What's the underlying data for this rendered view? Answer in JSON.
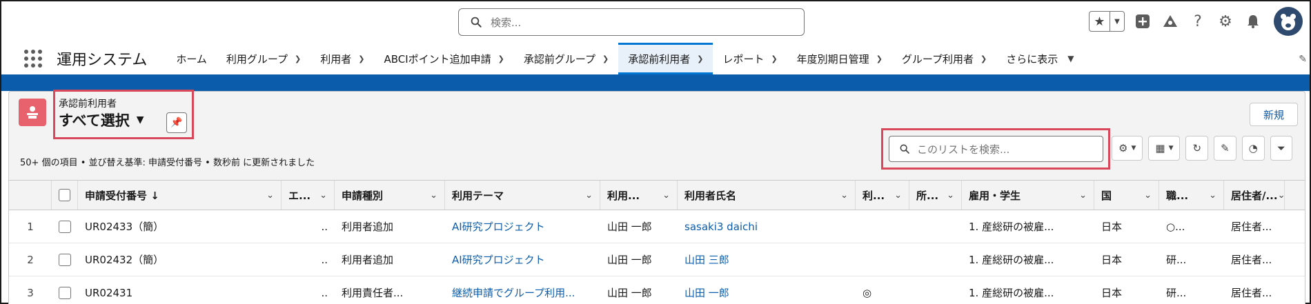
{
  "header": {
    "search_placeholder": "検索...",
    "icons": [
      "search-icon",
      "star-icon",
      "chevron-down-icon",
      "plus-icon",
      "trailhead-icon",
      "help-icon",
      "gear-icon",
      "bell-icon",
      "avatar"
    ]
  },
  "nav": {
    "app_name": "運用システム",
    "items": [
      {
        "label": "ホーム",
        "dropdown": false
      },
      {
        "label": "利用グループ",
        "dropdown": true
      },
      {
        "label": "利用者",
        "dropdown": true
      },
      {
        "label": "ABCIポイント追加申請",
        "dropdown": true
      },
      {
        "label": "承認前グループ",
        "dropdown": true
      },
      {
        "label": "承認前利用者",
        "dropdown": true,
        "active": true
      },
      {
        "label": "レポート",
        "dropdown": true
      },
      {
        "label": "年度別期日管理",
        "dropdown": true
      },
      {
        "label": "グループ利用者",
        "dropdown": true
      }
    ],
    "more_label": "さらに表示"
  },
  "list": {
    "object_label": "承認前利用者",
    "view_title": "すべて選択",
    "meta": "50+ 個の項目 • 並び替え基準: 申請受付番号 • 数秒前 に更新されました",
    "new_button": "新規",
    "search_placeholder": "このリストを検索..."
  },
  "table": {
    "columns": [
      "申請受付番号 ↓",
      "エ...",
      "申請種別",
      "利用テーマ",
      "利用...",
      "利用者氏名",
      "利...",
      "所...",
      "雇用・学生",
      "国",
      "職...",
      "居住者/..."
    ],
    "rows": [
      {
        "n": "1",
        "c": [
          "UR02433（簡）",
          "..",
          "利用者追加",
          "AI研究プロジェクト",
          "山田 一郎",
          "sasaki3 daichi",
          "",
          "",
          "1. 産総研の被雇...",
          "日本",
          "○...",
          "居住者..."
        ]
      },
      {
        "n": "2",
        "c": [
          "UR02432（簡）",
          "..",
          "利用者追加",
          "AI研究プロジェクト",
          "山田 一郎",
          "山田 三郎",
          "",
          "",
          "1. 産総研の被雇...",
          "日本",
          "研...",
          "居住者..."
        ]
      },
      {
        "n": "3",
        "c": [
          "UR02431",
          "..",
          "利用責任者...",
          "継続申請でグループ利用...",
          "山田 一郎",
          "山田 一郎",
          "◎",
          "",
          "1. 産総研の被雇...",
          "日本",
          "研...",
          "居住者..."
        ]
      }
    ]
  },
  "colors": {
    "accent": "#0b5cab",
    "object_icon": "#e8626d",
    "highlight": "#d9485a"
  }
}
